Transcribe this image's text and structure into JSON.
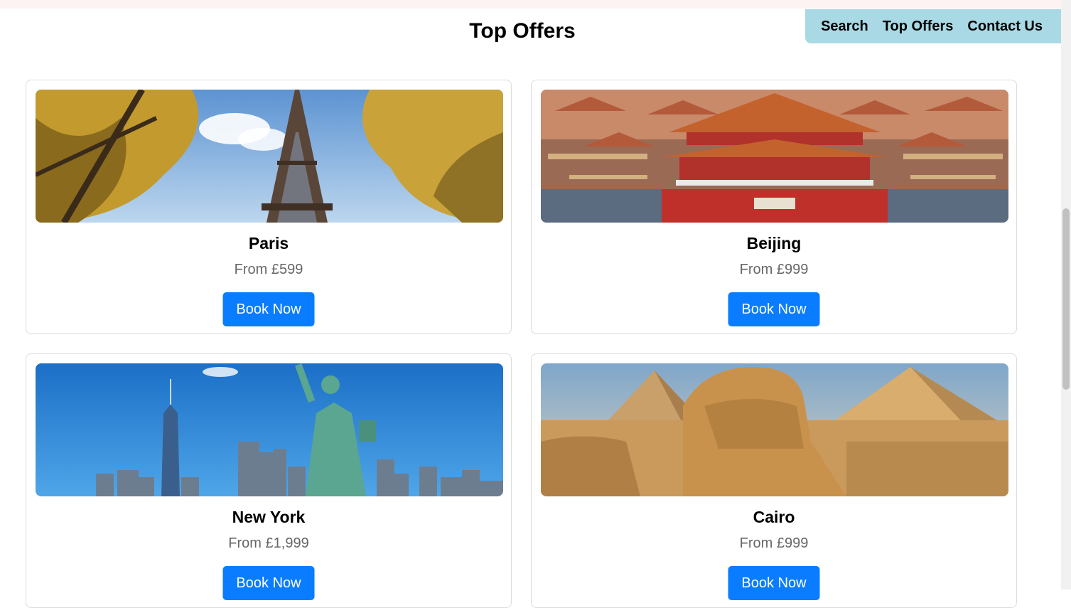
{
  "page_title": "Top Offers",
  "nav": {
    "links": [
      "Search",
      "Top Offers",
      "Contact Us"
    ]
  },
  "offers": [
    {
      "city": "Paris",
      "price": "From £599",
      "button": "Book Now",
      "image_icon": "eiffel-tower-image"
    },
    {
      "city": "Beijing",
      "price": "From £999",
      "button": "Book Now",
      "image_icon": "forbidden-city-image"
    },
    {
      "city": "New York",
      "price": "From £1,999",
      "button": "Book Now",
      "image_icon": "statue-of-liberty-image"
    },
    {
      "city": "Cairo",
      "price": "From £999",
      "button": "Book Now",
      "image_icon": "pyramids-sphinx-image"
    }
  ],
  "colors": {
    "nav_bg": "#a9d9e4",
    "button_bg": "#0a7cff",
    "price_text": "#666666"
  }
}
